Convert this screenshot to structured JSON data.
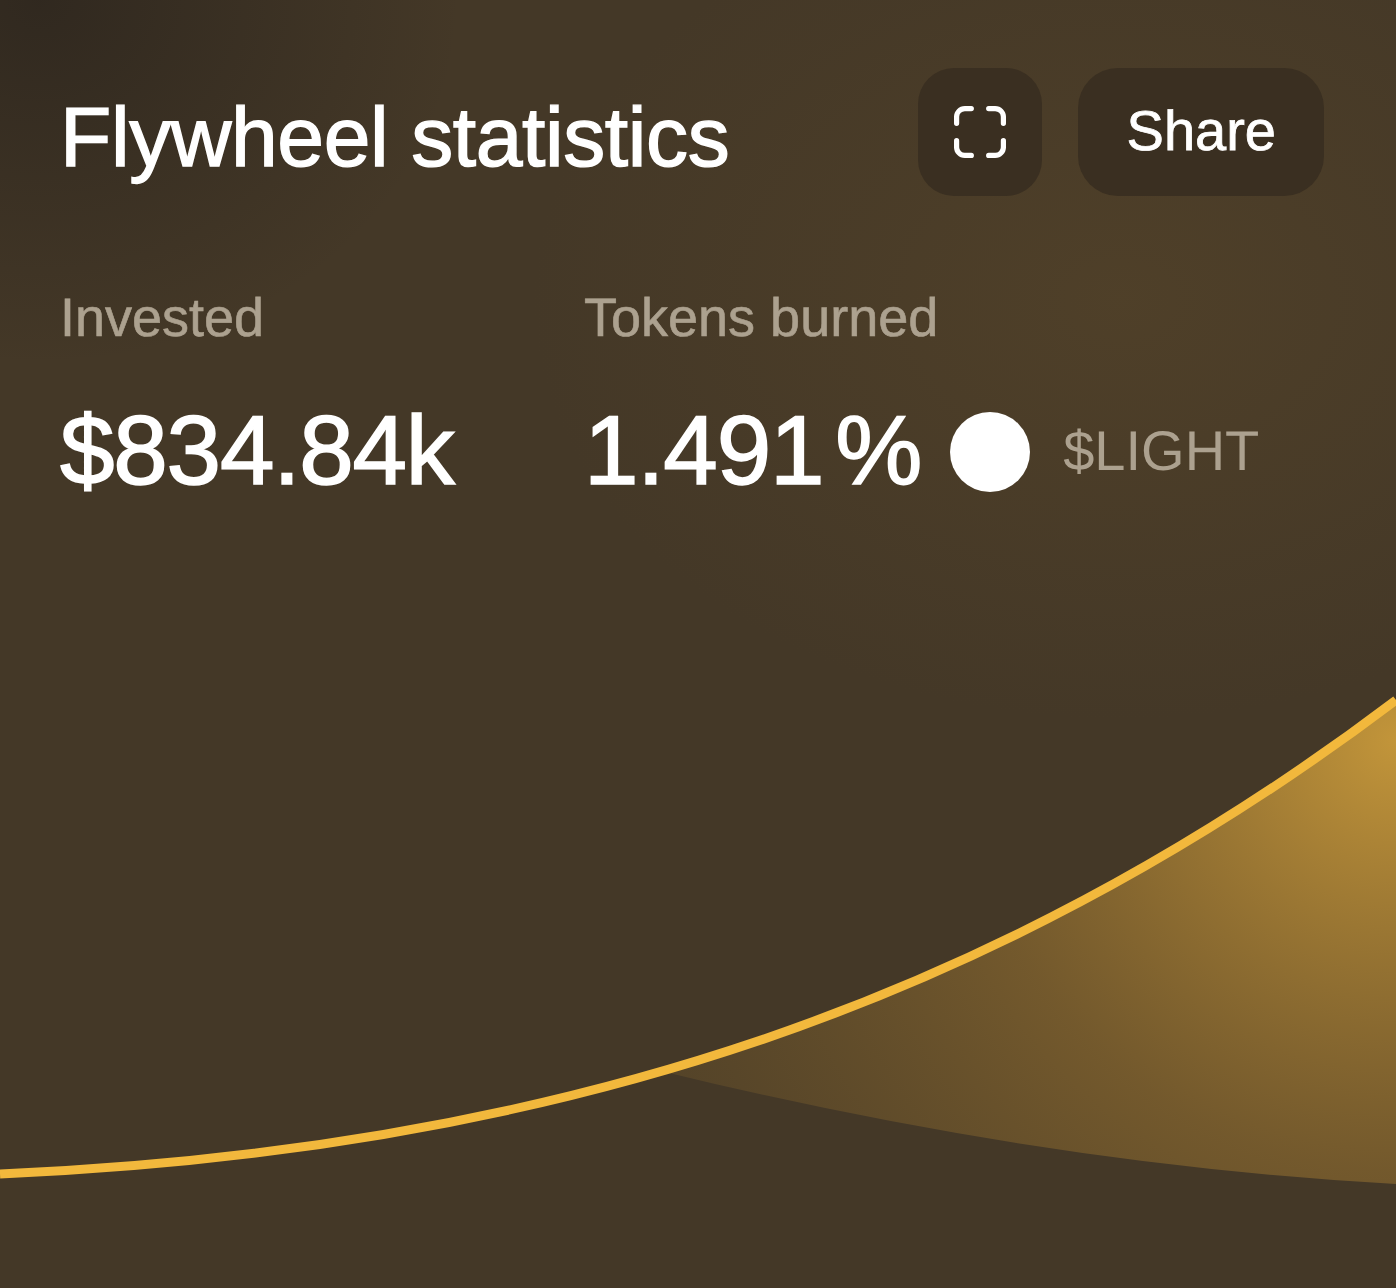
{
  "header": {
    "title": "Flywheel statistics",
    "share_button": {
      "label": "Share"
    }
  },
  "stats": [
    {
      "label": "Invested",
      "value": "$834.84k"
    },
    {
      "label": "Tokens burned",
      "value": "1.491 %",
      "token": "$LIGHT"
    }
  ]
}
